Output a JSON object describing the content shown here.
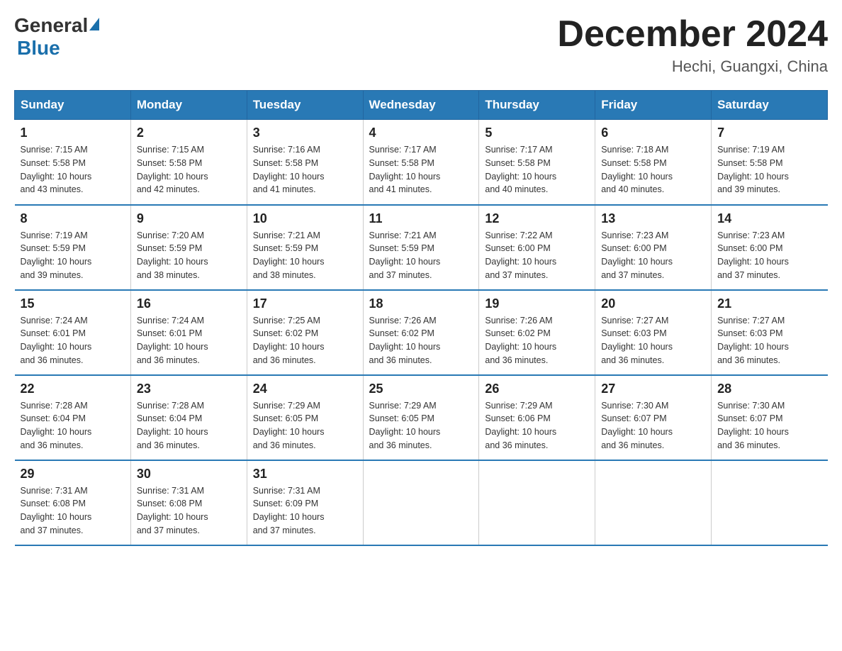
{
  "header": {
    "logo_general": "General",
    "logo_blue": "Blue",
    "title": "December 2024",
    "subtitle": "Hechi, Guangxi, China"
  },
  "days_of_week": [
    "Sunday",
    "Monday",
    "Tuesday",
    "Wednesday",
    "Thursday",
    "Friday",
    "Saturday"
  ],
  "weeks": [
    [
      {
        "day": "1",
        "sunrise": "7:15 AM",
        "sunset": "5:58 PM",
        "daylight": "10 hours and 43 minutes."
      },
      {
        "day": "2",
        "sunrise": "7:15 AM",
        "sunset": "5:58 PM",
        "daylight": "10 hours and 42 minutes."
      },
      {
        "day": "3",
        "sunrise": "7:16 AM",
        "sunset": "5:58 PM",
        "daylight": "10 hours and 41 minutes."
      },
      {
        "day": "4",
        "sunrise": "7:17 AM",
        "sunset": "5:58 PM",
        "daylight": "10 hours and 41 minutes."
      },
      {
        "day": "5",
        "sunrise": "7:17 AM",
        "sunset": "5:58 PM",
        "daylight": "10 hours and 40 minutes."
      },
      {
        "day": "6",
        "sunrise": "7:18 AM",
        "sunset": "5:58 PM",
        "daylight": "10 hours and 40 minutes."
      },
      {
        "day": "7",
        "sunrise": "7:19 AM",
        "sunset": "5:58 PM",
        "daylight": "10 hours and 39 minutes."
      }
    ],
    [
      {
        "day": "8",
        "sunrise": "7:19 AM",
        "sunset": "5:59 PM",
        "daylight": "10 hours and 39 minutes."
      },
      {
        "day": "9",
        "sunrise": "7:20 AM",
        "sunset": "5:59 PM",
        "daylight": "10 hours and 38 minutes."
      },
      {
        "day": "10",
        "sunrise": "7:21 AM",
        "sunset": "5:59 PM",
        "daylight": "10 hours and 38 minutes."
      },
      {
        "day": "11",
        "sunrise": "7:21 AM",
        "sunset": "5:59 PM",
        "daylight": "10 hours and 37 minutes."
      },
      {
        "day": "12",
        "sunrise": "7:22 AM",
        "sunset": "6:00 PM",
        "daylight": "10 hours and 37 minutes."
      },
      {
        "day": "13",
        "sunrise": "7:23 AM",
        "sunset": "6:00 PM",
        "daylight": "10 hours and 37 minutes."
      },
      {
        "day": "14",
        "sunrise": "7:23 AM",
        "sunset": "6:00 PM",
        "daylight": "10 hours and 37 minutes."
      }
    ],
    [
      {
        "day": "15",
        "sunrise": "7:24 AM",
        "sunset": "6:01 PM",
        "daylight": "10 hours and 36 minutes."
      },
      {
        "day": "16",
        "sunrise": "7:24 AM",
        "sunset": "6:01 PM",
        "daylight": "10 hours and 36 minutes."
      },
      {
        "day": "17",
        "sunrise": "7:25 AM",
        "sunset": "6:02 PM",
        "daylight": "10 hours and 36 minutes."
      },
      {
        "day": "18",
        "sunrise": "7:26 AM",
        "sunset": "6:02 PM",
        "daylight": "10 hours and 36 minutes."
      },
      {
        "day": "19",
        "sunrise": "7:26 AM",
        "sunset": "6:02 PM",
        "daylight": "10 hours and 36 minutes."
      },
      {
        "day": "20",
        "sunrise": "7:27 AM",
        "sunset": "6:03 PM",
        "daylight": "10 hours and 36 minutes."
      },
      {
        "day": "21",
        "sunrise": "7:27 AM",
        "sunset": "6:03 PM",
        "daylight": "10 hours and 36 minutes."
      }
    ],
    [
      {
        "day": "22",
        "sunrise": "7:28 AM",
        "sunset": "6:04 PM",
        "daylight": "10 hours and 36 minutes."
      },
      {
        "day": "23",
        "sunrise": "7:28 AM",
        "sunset": "6:04 PM",
        "daylight": "10 hours and 36 minutes."
      },
      {
        "day": "24",
        "sunrise": "7:29 AM",
        "sunset": "6:05 PM",
        "daylight": "10 hours and 36 minutes."
      },
      {
        "day": "25",
        "sunrise": "7:29 AM",
        "sunset": "6:05 PM",
        "daylight": "10 hours and 36 minutes."
      },
      {
        "day": "26",
        "sunrise": "7:29 AM",
        "sunset": "6:06 PM",
        "daylight": "10 hours and 36 minutes."
      },
      {
        "day": "27",
        "sunrise": "7:30 AM",
        "sunset": "6:07 PM",
        "daylight": "10 hours and 36 minutes."
      },
      {
        "day": "28",
        "sunrise": "7:30 AM",
        "sunset": "6:07 PM",
        "daylight": "10 hours and 36 minutes."
      }
    ],
    [
      {
        "day": "29",
        "sunrise": "7:31 AM",
        "sunset": "6:08 PM",
        "daylight": "10 hours and 37 minutes."
      },
      {
        "day": "30",
        "sunrise": "7:31 AM",
        "sunset": "6:08 PM",
        "daylight": "10 hours and 37 minutes."
      },
      {
        "day": "31",
        "sunrise": "7:31 AM",
        "sunset": "6:09 PM",
        "daylight": "10 hours and 37 minutes."
      },
      null,
      null,
      null,
      null
    ]
  ],
  "labels": {
    "sunrise": "Sunrise:",
    "sunset": "Sunset:",
    "daylight": "Daylight:"
  }
}
